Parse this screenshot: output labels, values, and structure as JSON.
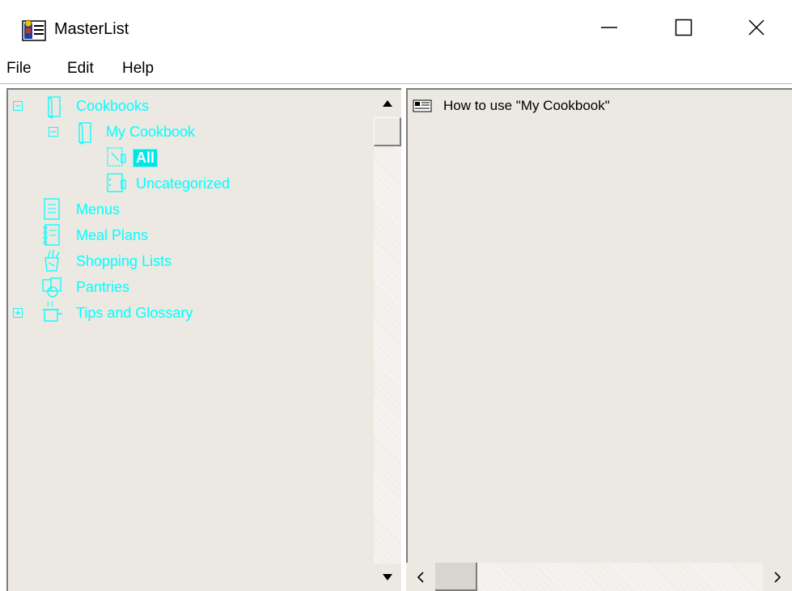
{
  "window": {
    "title": "MasterList",
    "icons": {
      "app": "masterlist-app-icon",
      "minimize": "minimize-icon",
      "maximize": "maximize-icon",
      "close": "close-icon"
    }
  },
  "menu": {
    "file": "File",
    "edit": "Edit",
    "help": "Help"
  },
  "tree": {
    "cookbooks": "Cookbooks",
    "my_cookbook": "My Cookbook",
    "all": "All",
    "uncategorized": "Uncategorized",
    "menus": "Menus",
    "meal_plans": "Meal Plans",
    "shopping_lists": "Shopping Lists",
    "pantries": "Pantries",
    "tips_glossary": "Tips and Glossary",
    "selected": "All",
    "color": "#00ffff"
  },
  "list": {
    "items": [
      {
        "label": "How to use \"My Cookbook\"",
        "icon": "document-icon"
      }
    ]
  },
  "colors": {
    "pane_bg": "#ece9e3",
    "tree_text": "#00ffff",
    "selection_bg": "#00e6e6"
  }
}
